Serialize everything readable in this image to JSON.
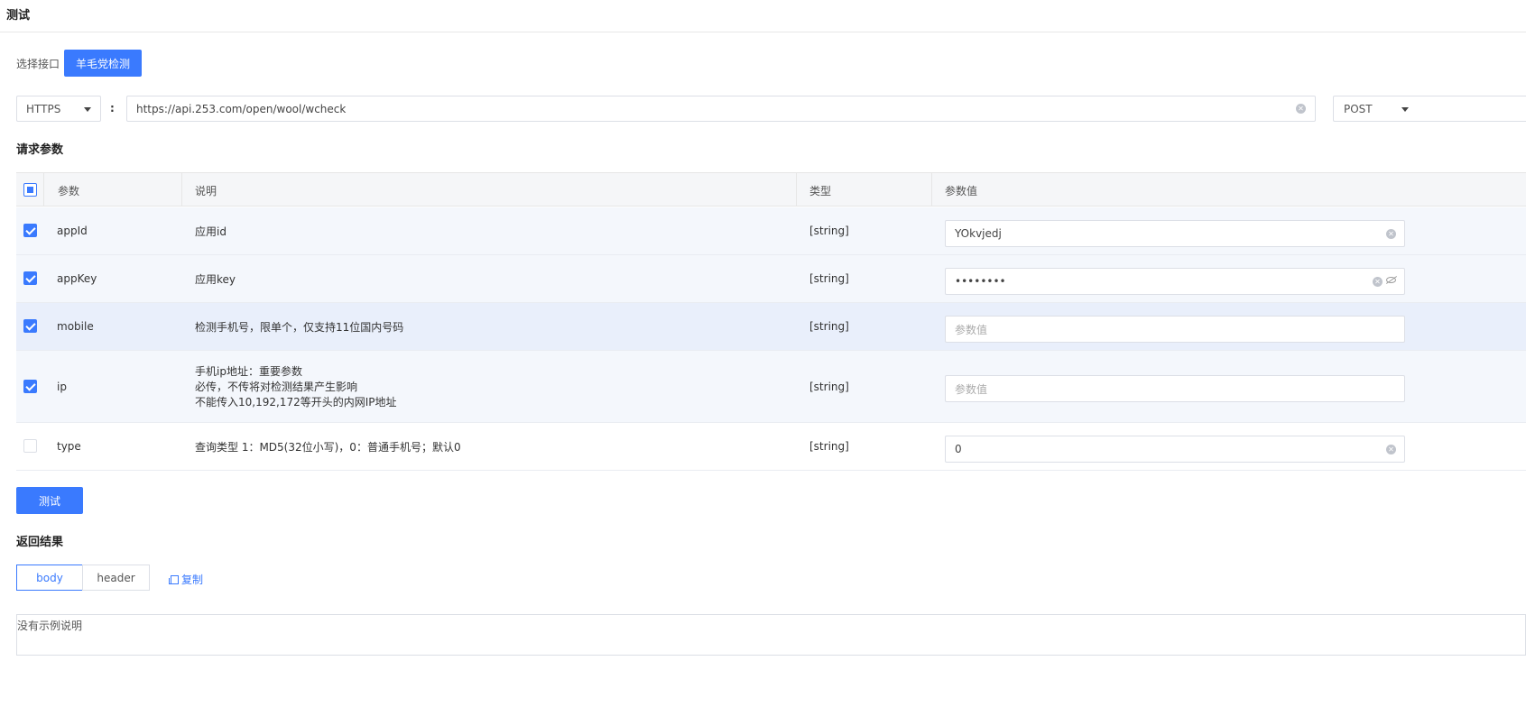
{
  "page": {
    "title": "测试"
  },
  "interface": {
    "label": "选择接口",
    "selected": "羊毛党检测"
  },
  "request": {
    "protocol": "HTTPS",
    "separator": ":",
    "url": "https://api.253.com/open/wool/wcheck",
    "method": "POST"
  },
  "params": {
    "title": "请求参数",
    "headers": {
      "param": "参数",
      "desc": "说明",
      "type": "类型",
      "value": "参数值"
    },
    "placeholder": "参数值",
    "rows": [
      {
        "name": "appId",
        "desc": [
          "应用id"
        ],
        "type": "[string]",
        "value": "YOkvjedj",
        "checked": true
      },
      {
        "name": "appKey",
        "desc": [
          "应用key"
        ],
        "type": "[string]",
        "value": "••••••••",
        "checked": true
      },
      {
        "name": "mobile",
        "desc": [
          "检测手机号，限单个，仅支持11位国内号码"
        ],
        "type": "[string]",
        "value": "",
        "checked": true
      },
      {
        "name": "ip",
        "desc": [
          "手机ip地址：重要参数",
          "必传，不传将对检测结果产生影响",
          "不能传入10,192,172等开头的内网IP地址"
        ],
        "type": "[string]",
        "value": "",
        "checked": true
      },
      {
        "name": "type",
        "desc": [
          "查询类型 1：MD5(32位小写)，0：普通手机号；默认0"
        ],
        "type": "[string]",
        "value": "0",
        "checked": false
      }
    ]
  },
  "actions": {
    "test_label": "测试"
  },
  "result": {
    "title": "返回结果",
    "tabs": [
      "body",
      "header"
    ],
    "copy_label": "复制",
    "content": "没有示例说明"
  },
  "colors": {
    "primary": "#3a7afe",
    "row_highlight": "#f0f4fb"
  }
}
